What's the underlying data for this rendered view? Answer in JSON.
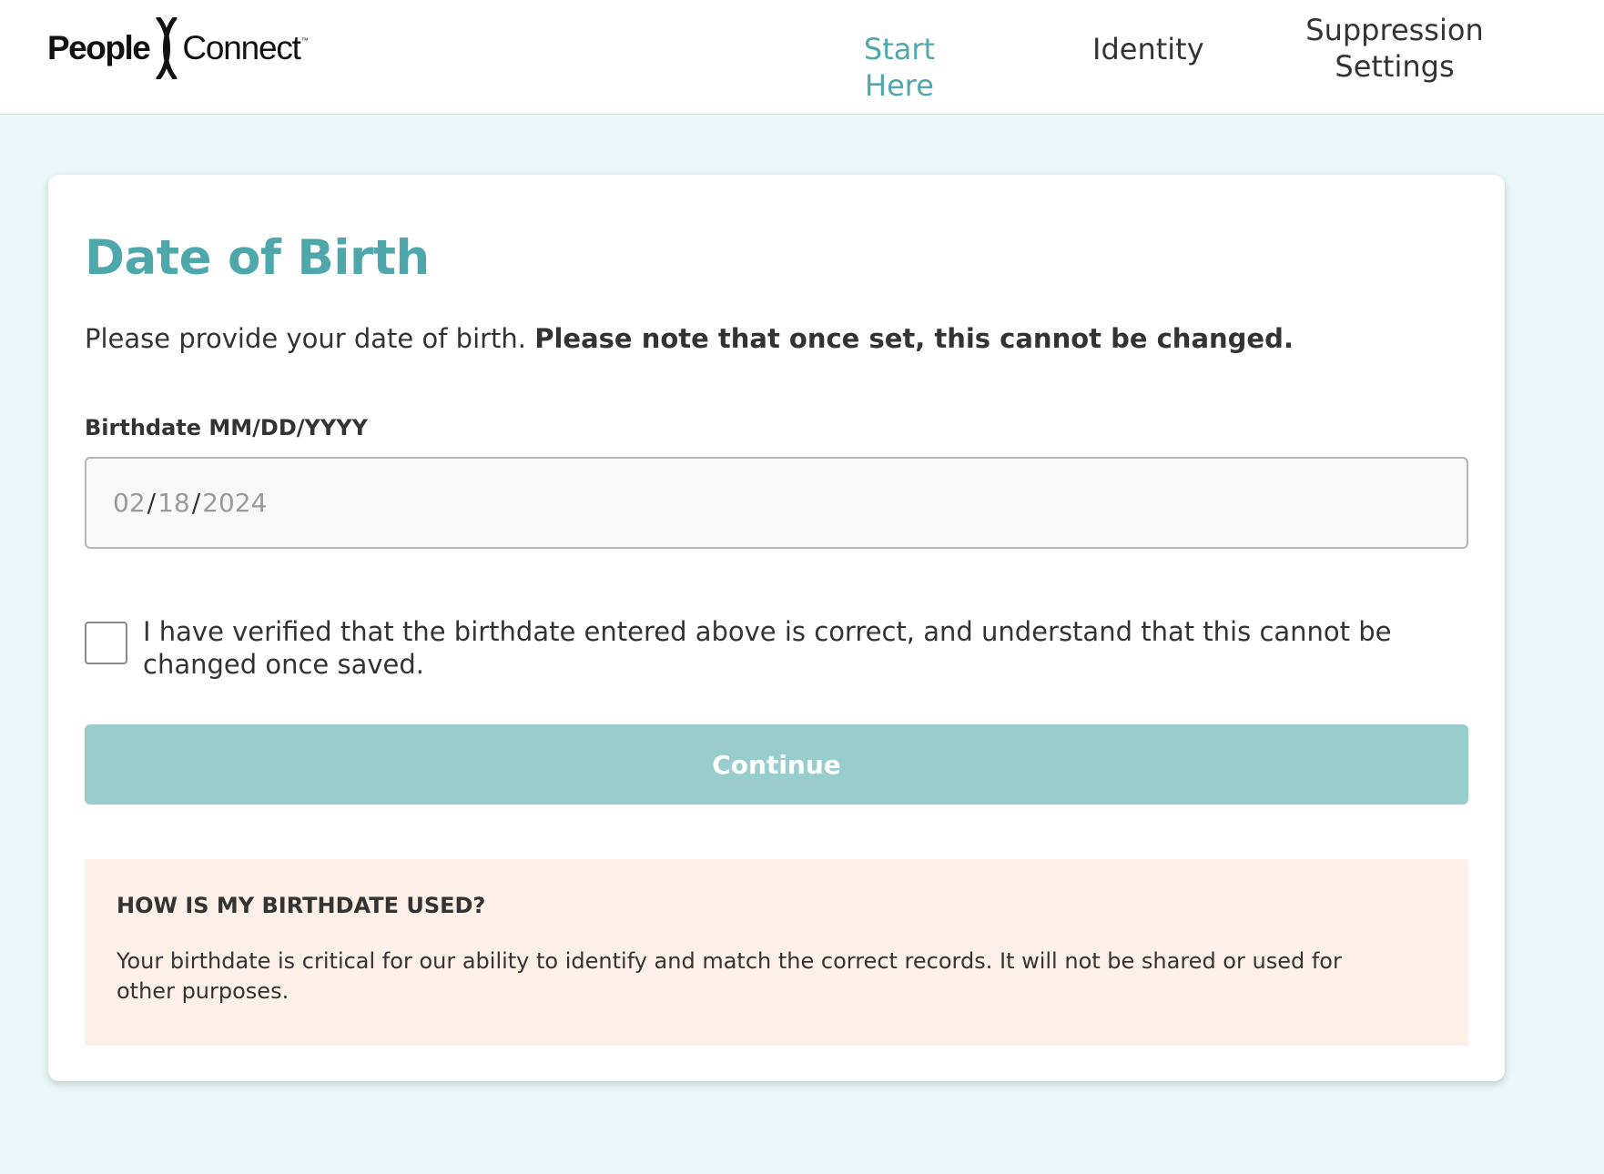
{
  "brand": {
    "name_part1": "People",
    "name_part2": "Connect",
    "trademark": "™"
  },
  "nav": {
    "items": [
      {
        "label": "Start Here",
        "active": true
      },
      {
        "label": "Identity",
        "active": false
      },
      {
        "label": "Suppression\nSettings",
        "active": false
      }
    ]
  },
  "card": {
    "title": "Date of Birth",
    "intro": "Please provide your date of birth.",
    "intro_bold": "Please note that once set, this cannot be changed.",
    "birthdate": {
      "label": "Birthdate MM/DD/YYYY",
      "month": "02",
      "day": "18",
      "year": "2024",
      "separator": "/"
    },
    "confirm": {
      "checked": false,
      "label": "I have verified that the birthdate entered above is correct, and understand that this cannot be changed once saved."
    },
    "continue_label": "Continue",
    "info": {
      "title": "HOW IS MY BIRTHDATE USED?",
      "text": "Your birthdate is critical for our ability to identify and match the correct records. It will not be shared or used for other purposes."
    }
  },
  "colors": {
    "accent": "#4ea8ab",
    "button_disabled": "#99cccd",
    "page_background": "#e8f7f7",
    "info_background": "#fcf0e9"
  }
}
